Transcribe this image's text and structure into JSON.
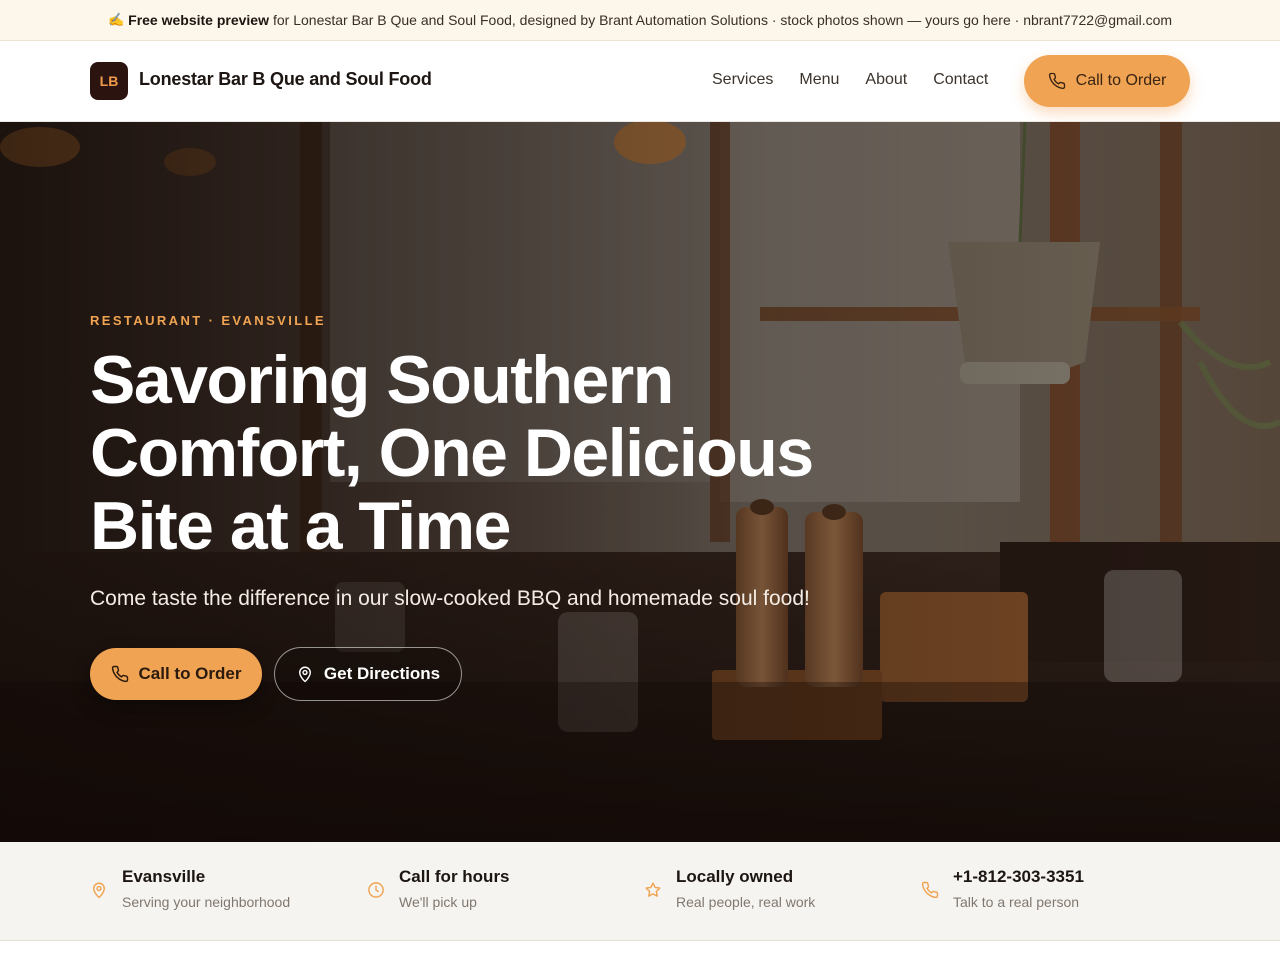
{
  "banner": {
    "emoji": "✍️",
    "bold": "Free website preview",
    "text": "for Lonestar Bar B Que and Soul Food, designed by Brant Automation Solutions · stock photos shown — yours go here · nbrant7722@gmail.com"
  },
  "header": {
    "logo_initials": "LB",
    "brand": "Lonestar Bar B Que and Soul Food",
    "nav": [
      "Services",
      "Menu",
      "About",
      "Contact"
    ],
    "cta": "Call to Order"
  },
  "hero": {
    "eyebrow": "RESTAURANT · EVANSVILLE",
    "headline": "Savoring Southern Comfort, One Delicious Bite at a Time",
    "subhead": "Come taste the difference in our slow-cooked BBQ and homemade soul food!",
    "primary_cta": "Call to Order",
    "secondary_cta": "Get Directions"
  },
  "info": [
    {
      "icon": "map-pin-icon",
      "title": "Evansville",
      "subtitle": "Serving your neighborhood"
    },
    {
      "icon": "clock-icon",
      "title": "Call for hours",
      "subtitle": "We'll pick up"
    },
    {
      "icon": "star-icon",
      "title": "Locally owned",
      "subtitle": "Real people, real work"
    },
    {
      "icon": "phone-icon",
      "title": "+1-812-303-3351",
      "subtitle": "Talk to a real person"
    }
  ],
  "colors": {
    "accent": "#f0a352",
    "dark": "#2b1410",
    "banner_bg": "#fcf7ea",
    "strip_bg": "#f6f4f0"
  }
}
